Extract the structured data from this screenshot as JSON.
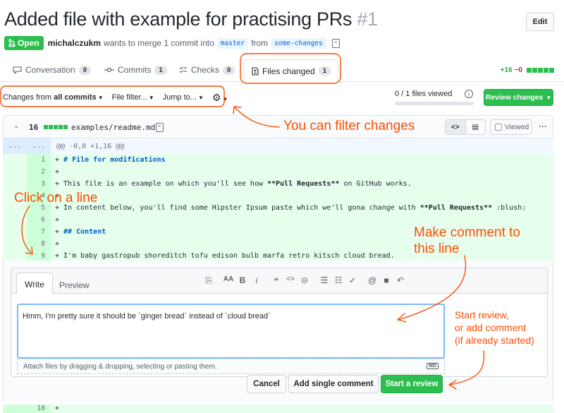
{
  "header": {
    "title": "Added file with example for practising PRs",
    "number": "#1",
    "edit_label": "Edit",
    "state": "Open",
    "author": "michalczukm",
    "merge_text": "wants to merge 1 commit into",
    "base_branch": "master",
    "from_text": "from",
    "head_branch": "some-changes"
  },
  "tabs": [
    {
      "label": "Conversation",
      "count": "0"
    },
    {
      "label": "Commits",
      "count": "1"
    },
    {
      "label": "Checks",
      "count": "0"
    },
    {
      "label": "Files changed",
      "count": "1"
    }
  ],
  "diffstat": {
    "additions": "+16",
    "deletions": "−0"
  },
  "toolbar": {
    "changes_prefix": "Changes from",
    "changes_value": "all commits",
    "file_filter": "File filter...",
    "jump_to": "Jump to...",
    "files_viewed": "0 / 1 files viewed",
    "review_button": "Review changes"
  },
  "file": {
    "count": "16",
    "name": "examples/readme.md",
    "viewed_label": "Viewed"
  },
  "diff": {
    "hunk_marks": [
      "...",
      "..."
    ],
    "hunk_header": "@@ -0,0 +1,16 @@",
    "lines": [
      {
        "n": "1",
        "text": "# File for modifications"
      },
      {
        "n": "2",
        "text": ""
      },
      {
        "n": "3",
        "text": "This file is an example on which you'll see how **Pull Requests** on GitHub works."
      },
      {
        "n": "4",
        "text": ""
      },
      {
        "n": "5",
        "text": "In content below, you'll find some Hipster Ipsum paste which we'll gona change with **Pull Requests** :blush:"
      },
      {
        "n": "6",
        "text": ""
      },
      {
        "n": "7",
        "text": "## Content"
      },
      {
        "n": "8",
        "text": ""
      },
      {
        "n": "9",
        "text": "I'm baby gastropub shoreditch tofu edison bulb marfa retro kitsch cloud bread."
      }
    ],
    "last_line_number": "10",
    "plus": "+"
  },
  "comment_form": {
    "tab_write": "Write",
    "tab_preview": "Preview",
    "toolbar_icons": [
      "file-icon",
      "text-size-icon",
      "bold-icon",
      "italic-icon",
      "quote-icon",
      "code-icon",
      "link-icon",
      "bulleted-list-icon",
      "numbered-list-icon",
      "task-list-icon",
      "mention-icon",
      "bookmark-icon",
      "reply-icon"
    ],
    "text": "Hmm, I'm pretty sure it should be `ginger bread` instead of `cloud bread`",
    "attach_hint": "Attach files by dragging & dropping, selecting or pasting them.",
    "markdown_badge": "MD",
    "cancel": "Cancel",
    "add_single": "Add single comment",
    "start_review": "Start a review"
  },
  "annotations": {
    "filter": "You can filter changes",
    "click_line": "Click on a line",
    "make_comment_1": "Make comment to",
    "make_comment_2": "this line",
    "start_review_1": "Start review,",
    "start_review_2": "or add comment",
    "start_review_3": "(if already started)"
  },
  "colors": {
    "accent_green": "#2cbe4e",
    "annotation_orange": "#ff4d00",
    "addition_bg": "#e6ffed"
  }
}
